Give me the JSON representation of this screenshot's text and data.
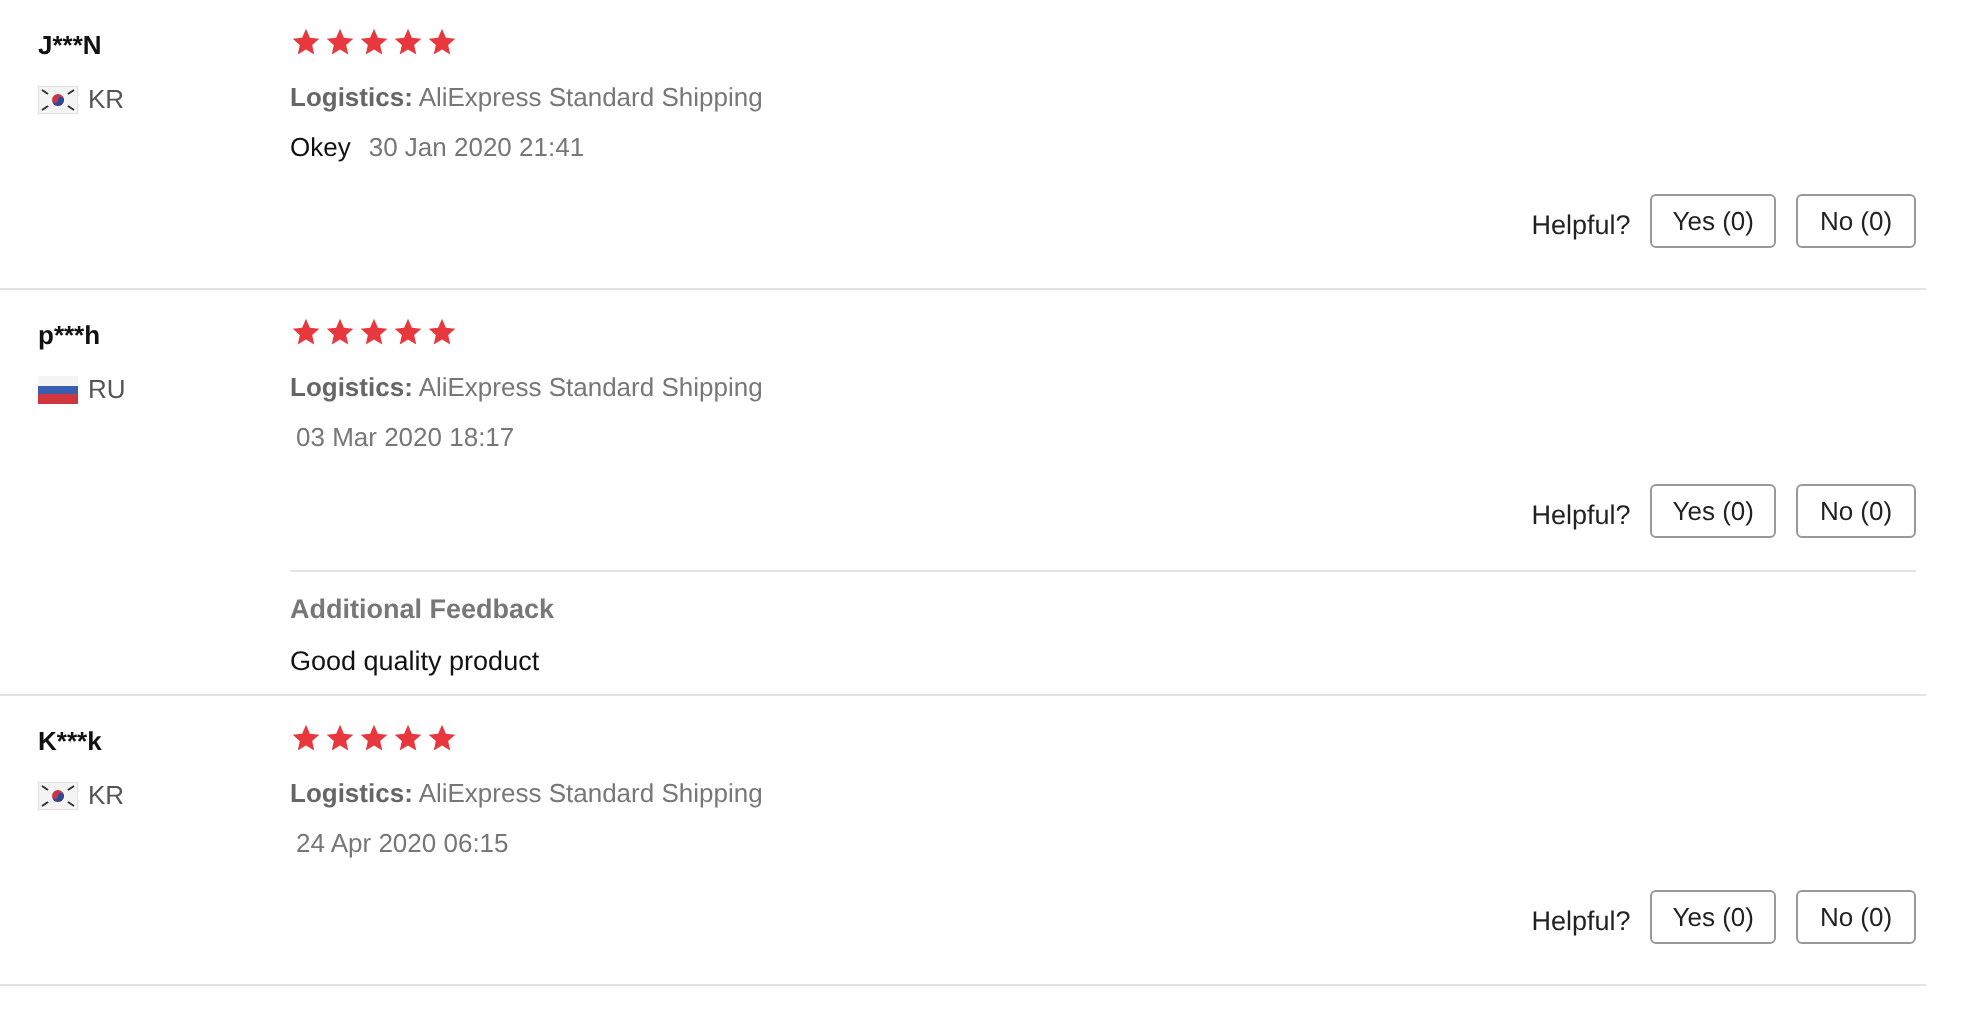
{
  "reviews": [
    {
      "user": "J***N",
      "kind": "kr",
      "country": "KR",
      "stars": 5,
      "logistics_label": "Logistics:",
      "logistics": "AliExpress Standard Shipping",
      "comment": "Okey",
      "date": "30 Jan 2020 21:41",
      "helpful_label": "Helpful?",
      "yes": "Yes (0)",
      "no": "No (0)"
    },
    {
      "user": "p***h",
      "kind": "ru",
      "country": "RU",
      "stars": 5,
      "logistics_label": "Logistics:",
      "logistics": "AliExpress Standard Shipping",
      "date": "03 Mar 2020 18:17",
      "helpful_label": "Helpful?",
      "yes": "Yes (0)",
      "no": "No (0)",
      "additional": {
        "title": "Additional Feedback",
        "text": "Good quality product"
      }
    },
    {
      "user": "K***k",
      "kind": "kr",
      "country": "KR",
      "stars": 5,
      "logistics_label": "Logistics:",
      "logistics": "AliExpress Standard Shipping",
      "date": "24 Apr 2020 06:15",
      "helpful_label": "Helpful?",
      "yes": "Yes (0)",
      "no": "No (0)"
    }
  ]
}
